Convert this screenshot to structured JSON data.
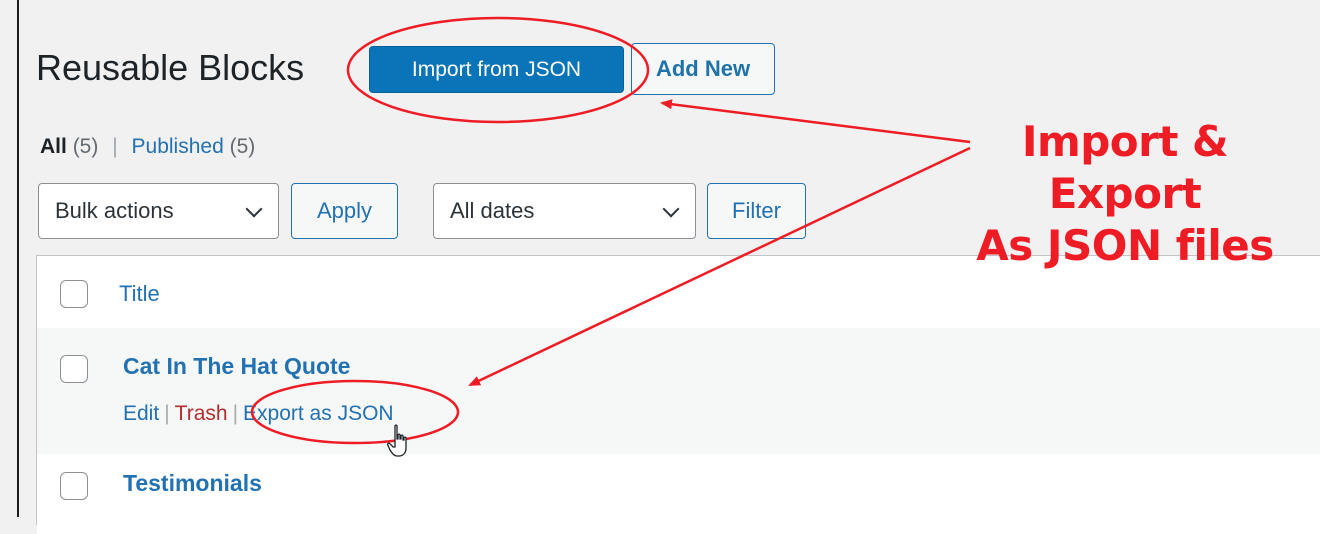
{
  "header": {
    "title": "Reusable Blocks",
    "import_button": "Import from JSON",
    "add_new_button": "Add New"
  },
  "filters": {
    "all_label": "All",
    "all_count": "(5)",
    "separator": "|",
    "published_label": "Published",
    "published_count": "(5)"
  },
  "toolbar": {
    "bulk_actions": "Bulk actions",
    "apply_button": "Apply",
    "dates_select": "All dates",
    "filter_button": "Filter"
  },
  "table": {
    "column_title": "Title",
    "rows": [
      {
        "title": "Cat In The Hat Quote",
        "actions": {
          "edit": "Edit",
          "trash": "Trash",
          "export": "Export as JSON"
        }
      },
      {
        "title": "Testimonials"
      }
    ]
  },
  "annotation": {
    "line1": "Import & Export",
    "line2": "As JSON files",
    "color": "#ee1c24"
  },
  "colors": {
    "primary": "#0a74b8",
    "link": "#2271b1",
    "trash": "#b32d2e"
  }
}
